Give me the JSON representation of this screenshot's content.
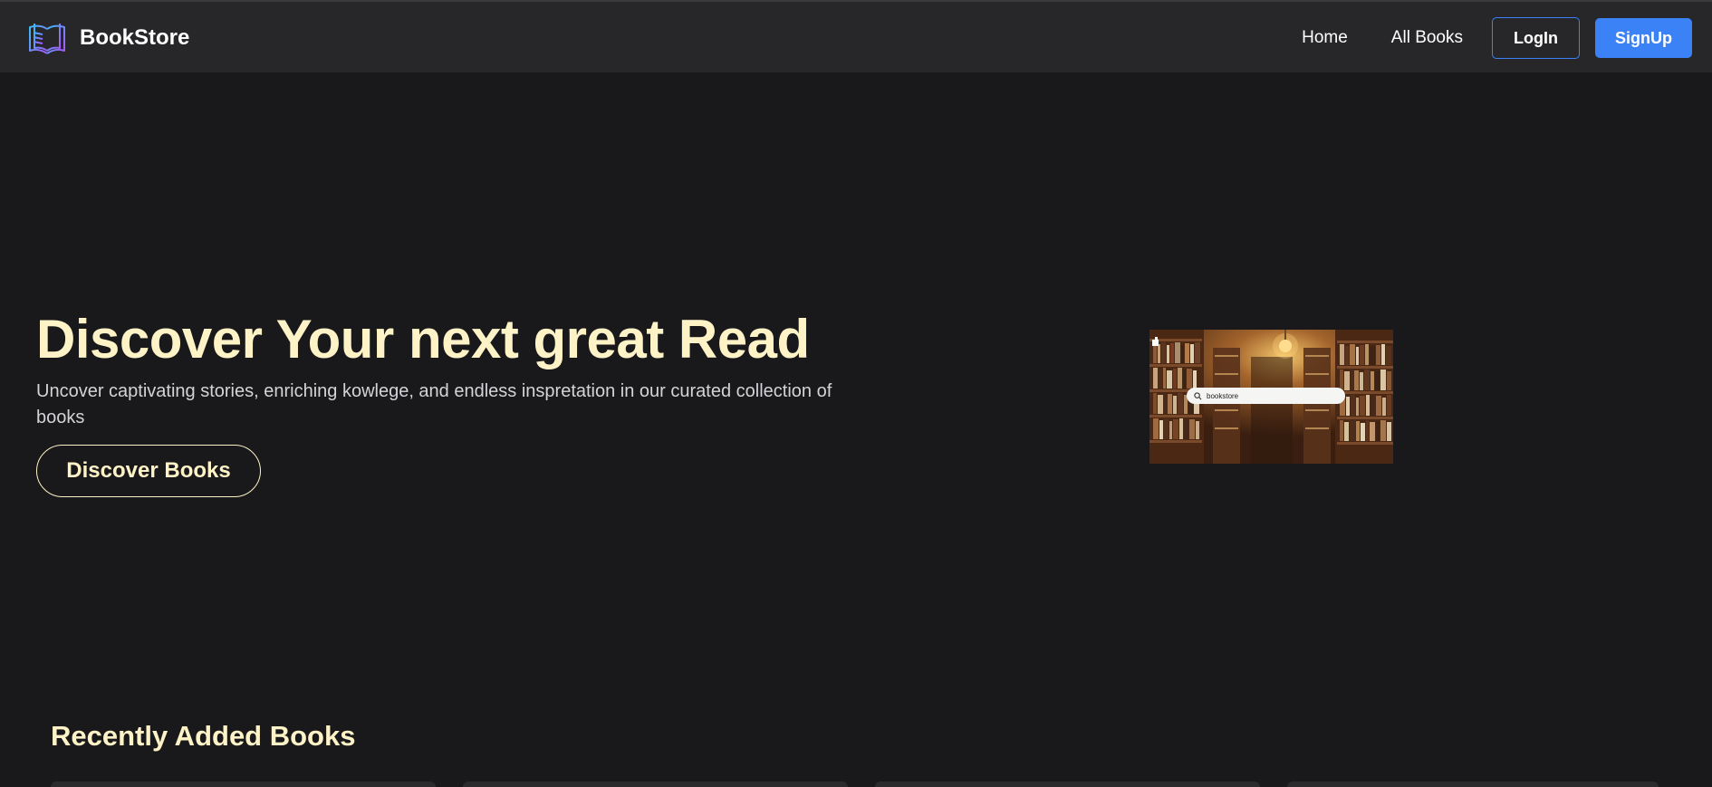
{
  "navbar": {
    "brand": "BookStore",
    "links": [
      "Home",
      "All Books"
    ],
    "login_label": "LogIn",
    "signup_label": "SignUp"
  },
  "hero": {
    "title": "Discover Your next great Read",
    "subtitle": "Uncover captivating stories, enriching kowlege, and endless inspretation in our curated collection of books",
    "cta_label": "Discover Books",
    "image": {
      "search_text": "bookstore"
    }
  },
  "recent": {
    "title": "Recently Added Books"
  },
  "colors": {
    "background": "#19191b",
    "navbar": "#27272a",
    "accent_cream": "#fef3c7",
    "accent_blue": "#3b82f6"
  },
  "icons": {
    "brand": "open-book-icon",
    "search": "search-icon"
  }
}
